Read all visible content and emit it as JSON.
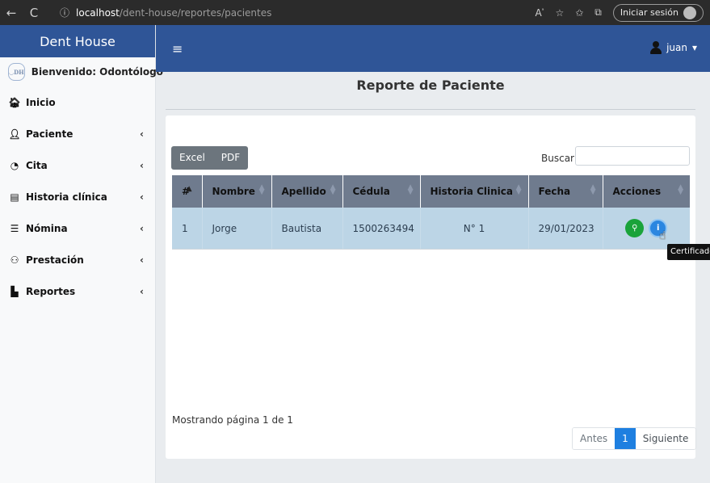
{
  "browser": {
    "back_icon": "←",
    "reload_icon": "C",
    "info_icon": "ⓘ",
    "url_host": "localhost",
    "url_path": "/dent-house/reportes/pacientes",
    "signin_label": "Iniciar sesión"
  },
  "sidebar": {
    "brand": "Dent House",
    "logo_text": "DENT HOUSE",
    "welcome": "Bienvenido: Odontólogo",
    "items": [
      {
        "label": "Inicio",
        "icon": "home-icon",
        "glyph": "🏠︎",
        "has_chevron": false
      },
      {
        "label": "Paciente",
        "icon": "user-icon",
        "glyph": "👤︎",
        "has_chevron": true
      },
      {
        "label": "Cita",
        "icon": "clock-icon",
        "glyph": "◔",
        "has_chevron": true
      },
      {
        "label": "Historia clínica",
        "icon": "id-card-icon",
        "glyph": "▤",
        "has_chevron": true
      },
      {
        "label": "Nómina",
        "icon": "list-icon",
        "glyph": "☰",
        "has_chevron": true
      },
      {
        "label": "Prestación",
        "icon": "users-icon",
        "glyph": "⚇",
        "has_chevron": true
      },
      {
        "label": "Reportes",
        "icon": "file-pdf-icon",
        "glyph": "▙",
        "has_chevron": true
      }
    ],
    "chevron": "‹"
  },
  "header": {
    "menu_icon": "≡",
    "user_name": "juan",
    "caret": "▾"
  },
  "main": {
    "title": "Reporte de Paciente",
    "export_buttons": [
      "Excel",
      "PDF"
    ],
    "search_label": "Buscar",
    "search_value": "",
    "columns": [
      "#",
      "Nombre",
      "Apellido",
      "Cédula",
      "Historia Clinica",
      "Fecha",
      "Acciones"
    ],
    "rows": [
      {
        "num": "1",
        "nombre": "Jorge",
        "apellido": "Bautista",
        "cedula": "1500263494",
        "historia": "N° 1",
        "fecha": "29/01/2023"
      }
    ],
    "tooltip": "Certificado",
    "footer_info": "Mostrando página 1 de 1",
    "pagination": {
      "prev": "Antes",
      "current": "1",
      "next": "Siguiente"
    }
  },
  "colors": {
    "brand_blue": "#2f5597",
    "table_header": "#6f7b8e",
    "row_highlight": "#bcd5e6",
    "btn_green": "#1aa33a",
    "btn_blue": "#2b86e0",
    "page_active": "#1e7fe0"
  }
}
